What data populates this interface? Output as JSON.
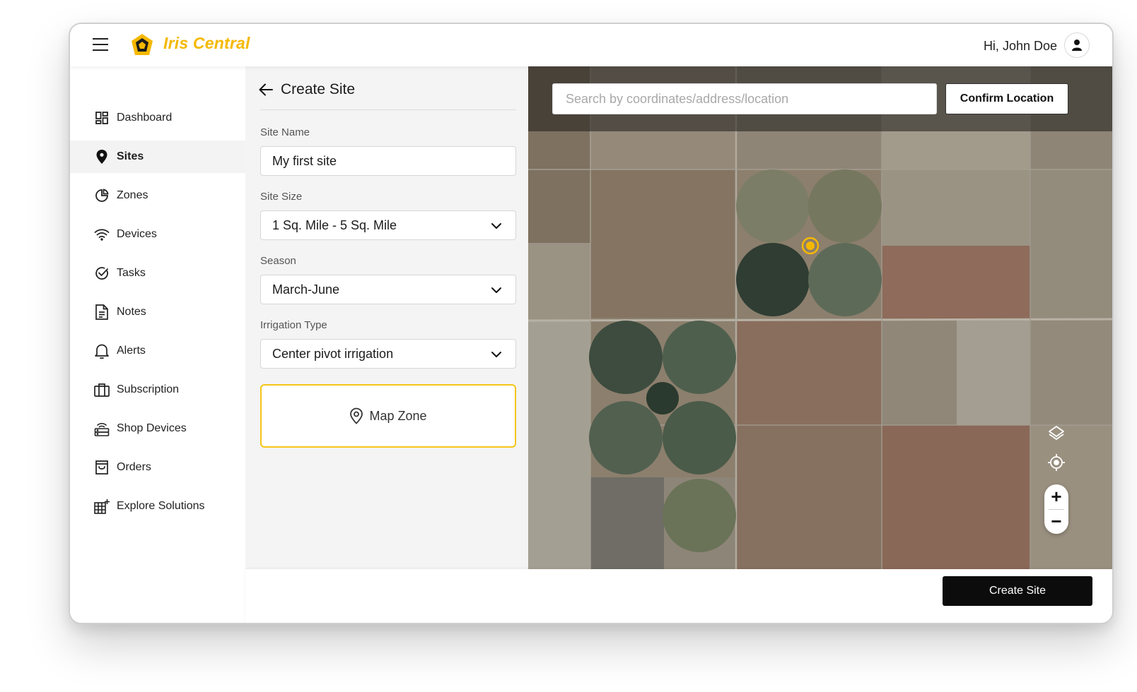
{
  "app": {
    "name": "Iris Central",
    "brand_color": "#f5b800"
  },
  "header": {
    "greeting": "Hi, John Doe",
    "menu_icon": "hamburger-menu-icon",
    "avatar_icon": "user-icon"
  },
  "sidebar": {
    "items": [
      {
        "label": "Dashboard",
        "icon": "dashboard-grid-icon",
        "active": false
      },
      {
        "label": "Sites",
        "icon": "map-pin-icon",
        "active": true
      },
      {
        "label": "Zones",
        "icon": "pie-chart-icon",
        "active": false
      },
      {
        "label": "Devices",
        "icon": "wifi-icon",
        "active": false
      },
      {
        "label": "Tasks",
        "icon": "check-circle-icon",
        "active": false
      },
      {
        "label": "Notes",
        "icon": "document-icon",
        "active": false
      },
      {
        "label": "Alerts",
        "icon": "bell-icon",
        "active": false
      },
      {
        "label": "Subscription",
        "icon": "gift-box-icon",
        "active": false
      },
      {
        "label": "Shop Devices",
        "icon": "router-icon",
        "active": false
      },
      {
        "label": "Orders",
        "icon": "shopping-bag-icon",
        "active": false
      },
      {
        "label": "Explore Solutions",
        "icon": "grid-plus-icon",
        "active": false
      }
    ]
  },
  "form": {
    "title": "Create Site",
    "site_name": {
      "label": "Site Name",
      "value": "My first site"
    },
    "site_size": {
      "label": "Site Size",
      "value": "1 Sq. Mile - 5 Sq. Mile"
    },
    "season": {
      "label": "Season",
      "value": "March-June"
    },
    "irrigation_type": {
      "label": "Irrigation Type",
      "value": "Center pivot irrigation"
    },
    "map_zone_label": "Map Zone"
  },
  "map": {
    "search_placeholder": "Search by coordinates/address/location",
    "confirm_label": "Confirm Location",
    "zoom_in_label": "+",
    "zoom_out_label": "−",
    "marker_color": "#f5b800"
  },
  "footer": {
    "create_label": "Create Site"
  }
}
